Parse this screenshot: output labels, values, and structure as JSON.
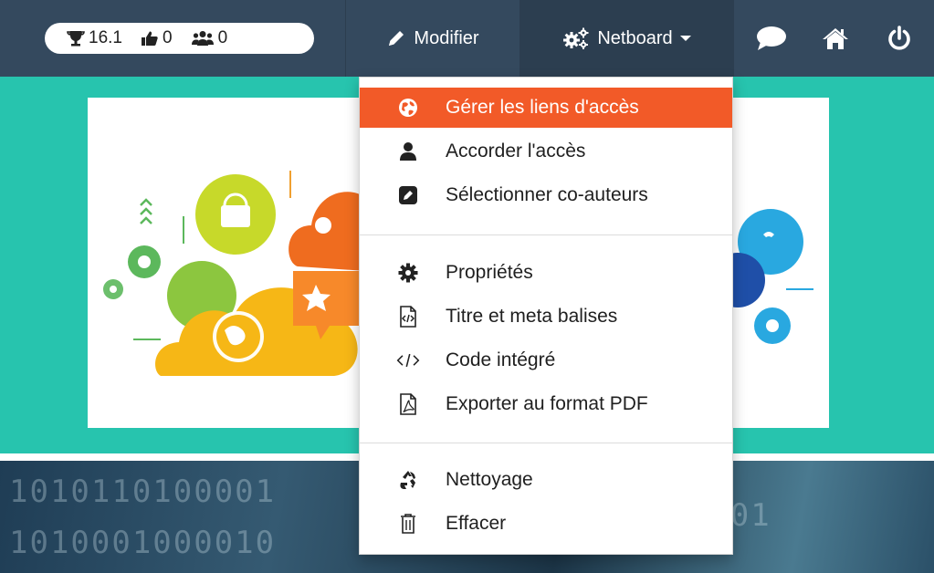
{
  "stats": {
    "score": "16.1",
    "likes": "0",
    "members": "0"
  },
  "nav": {
    "modifier_label": "Modifier",
    "netboard_label": "Netboard"
  },
  "menu": {
    "items": [
      {
        "label": "Gérer les liens d'accès",
        "icon": "globe-icon",
        "active": true
      },
      {
        "label": "Accorder l'accès",
        "icon": "user-icon"
      },
      {
        "label": "Sélectionner co-auteurs",
        "icon": "pencil-square-icon"
      },
      {
        "label": "Propriétés",
        "icon": "gear-icon"
      },
      {
        "label": "Titre et meta balises",
        "icon": "code-file-icon"
      },
      {
        "label": "Code intégré",
        "icon": "code-icon"
      },
      {
        "label": "Exporter au format PDF",
        "icon": "pdf-file-icon"
      },
      {
        "label": "Nettoyage",
        "icon": "recycle-icon"
      },
      {
        "label": "Effacer",
        "icon": "trash-icon"
      }
    ]
  },
  "colors": {
    "navbar": "#34495e",
    "teal": "#27c4ae",
    "accent": "#f25a28"
  }
}
